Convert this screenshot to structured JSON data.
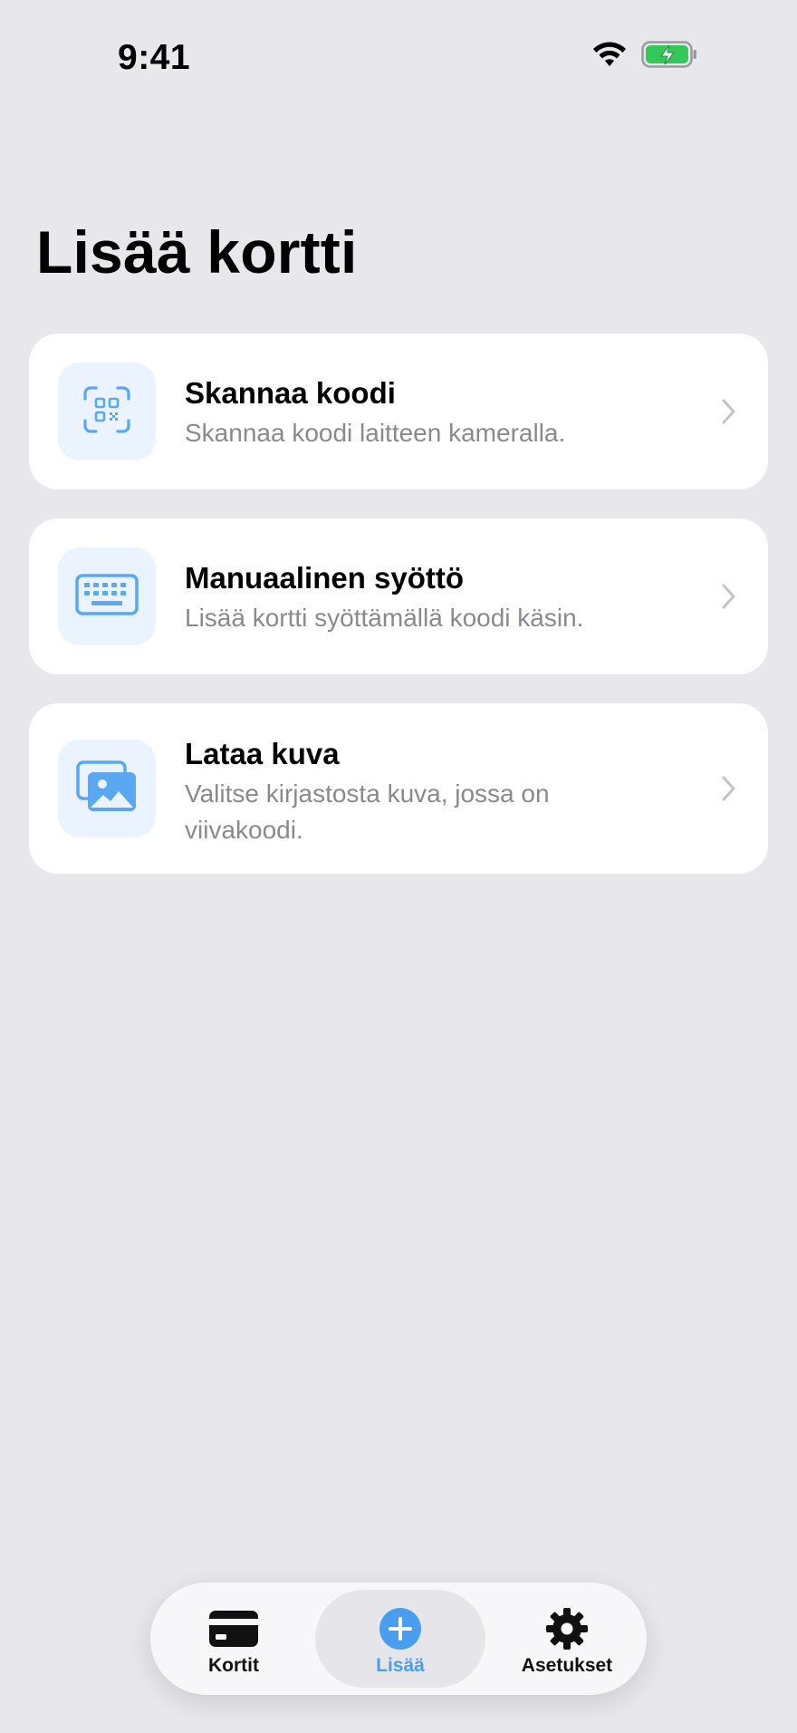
{
  "status_bar": {
    "time": "9:41"
  },
  "page": {
    "title": "Lisää kortti"
  },
  "options": [
    {
      "title": "Skannaa koodi",
      "subtitle": "Skannaa koodi laitteen kameralla.",
      "icon": "qr-scan-icon"
    },
    {
      "title": "Manuaalinen syöttö",
      "subtitle": "Lisää kortti syöttämällä koodi käsin.",
      "icon": "keyboard-icon"
    },
    {
      "title": "Lataa kuva",
      "subtitle": "Valitse kirjastosta kuva, jossa on viivakoodi.",
      "icon": "photo-library-icon"
    }
  ],
  "tab_bar": {
    "tabs": [
      {
        "label": "Kortit",
        "icon": "card-icon"
      },
      {
        "label": "Lisää",
        "icon": "plus-circle-icon",
        "selected": true
      },
      {
        "label": "Asetukset",
        "icon": "gear-icon"
      }
    ]
  },
  "colors": {
    "accent": "#4A9EF0",
    "background": "#E7E7EC",
    "card": "#FFFFFF",
    "icon_tile": "#EAF3FF",
    "battery": "#34C759"
  }
}
